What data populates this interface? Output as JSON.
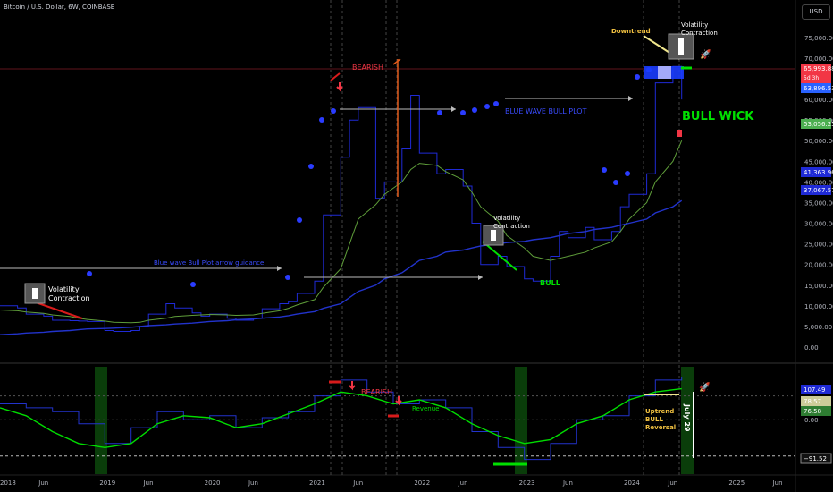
{
  "header": {
    "title": "Bitcoin / U.S. Dollar, 6W, COINBASE",
    "currency": "USD"
  },
  "price_axis": {
    "ticks": [
      "75,000.00",
      "70,000.00",
      "60,000.00",
      "55,000.00",
      "50,000.00",
      "45,000.00",
      "40,000.00",
      "35,000.00",
      "30,000.00",
      "25,000.00",
      "20,000.00",
      "15,000.00",
      "10,000.00",
      "5,000.00",
      "0.00"
    ],
    "badges": [
      {
        "label": "65,993.88",
        "sub": "5d 3h",
        "color": "#f23645"
      },
      {
        "label": "63,896.53",
        "color": "#2962ff"
      },
      {
        "label": "53,056.25",
        "color": "#4caf50"
      },
      {
        "label": "41,363.96",
        "color": "#1f2ad6"
      },
      {
        "label": "37,067.57",
        "color": "#1f2ad6"
      }
    ]
  },
  "osc_axis": {
    "ticks": [
      "0.00"
    ],
    "badges": [
      {
        "label": "107.49",
        "color": "#1f2ad6"
      },
      {
        "label": "78.57",
        "color": "#cccc99"
      },
      {
        "label": "76.58",
        "color": "#2e7d32"
      },
      {
        "label": "−91.52",
        "color": "#111"
      }
    ]
  },
  "time_axis": [
    "2018",
    "Jun",
    "2019",
    "Jun",
    "2020",
    "Jun",
    "2021",
    "Jun",
    "2022",
    "Jun",
    "2023",
    "Jun",
    "2024",
    "Jun",
    "2025",
    "Jun"
  ],
  "annotations": {
    "bearish": "BEARISH",
    "vc_left": "Volatility\nContraction",
    "vc_mid": "Volatility\nContraction",
    "vc_top": "Volatility\nContraction",
    "downtrend": "Downtrend",
    "bull_wick": "BULL WICK",
    "blue_wave": "BLUE WAVE BULL PLOT",
    "blue_wave_guidance": "Blue wave Bull Plot arrow guidance",
    "bull": "BULL",
    "osc_bearish": "BEARISH",
    "revenue": "Revenue",
    "uptrend": "Uptrend\nBULL\nReversal",
    "july": "July 29"
  },
  "chart_data": [
    {
      "type": "line",
      "title": "Bitcoin / U.S. Dollar, 6W, COINBASE",
      "x": [
        "2018-01",
        "2018-03",
        "2018-04",
        "2018-06",
        "2018-07",
        "2018-09",
        "2018-10",
        "2018-11",
        "2019-01",
        "2019-02",
        "2019-04",
        "2019-05",
        "2019-06",
        "2019-08",
        "2019-09",
        "2019-11",
        "2019-12",
        "2020-01",
        "2020-03",
        "2020-04",
        "2020-06",
        "2020-07",
        "2020-09",
        "2020-10",
        "2020-11",
        "2021-01",
        "2021-02",
        "2021-04",
        "2021-05",
        "2021-06",
        "2021-08",
        "2021-09",
        "2021-11",
        "2021-12",
        "2022-01",
        "2022-03",
        "2022-04",
        "2022-06",
        "2022-07",
        "2022-08",
        "2022-10",
        "2022-11",
        "2023-01",
        "2023-02",
        "2023-04",
        "2023-05",
        "2023-06",
        "2023-08",
        "2023-09",
        "2023-11",
        "2023-12",
        "2024-01",
        "2024-03",
        "2024-04",
        "2024-06",
        "2024-07"
      ],
      "series": [
        {
          "values": [
            10000,
            9500,
            8000,
            7500,
            6500,
            6400,
            6300,
            6200,
            4000,
            3800,
            4000,
            5000,
            8000,
            10500,
            9500,
            8300,
            7500,
            8000,
            7000,
            6500,
            7000,
            9300,
            10500,
            11000,
            13000,
            16000,
            32000,
            46000,
            55000,
            58000,
            36000,
            40000,
            48000,
            61000,
            47000,
            42000,
            43000,
            39000,
            30000,
            20000,
            22000,
            19500,
            16500,
            16000,
            22000,
            28000,
            26500,
            29000,
            26000,
            28000,
            34000,
            37000,
            42000,
            64000,
            68000,
            60000
          ]
        },
        {
          "values": [
            9000,
            8800,
            8500,
            8200,
            7800,
            7400,
            7000,
            6700,
            6300,
            6000,
            5900,
            6000,
            6500,
            7000,
            7400,
            7700,
            7800,
            7900,
            7800,
            7700,
            7800,
            8200,
            8800,
            9400,
            10200,
            11500,
            14500,
            19000,
            25000,
            31000,
            34500,
            37000,
            40000,
            43000,
            44500,
            44000,
            42500,
            40500,
            37500,
            34000,
            30500,
            27000,
            24000,
            22000,
            21000,
            21500,
            22000,
            23000,
            24000,
            25500,
            28000,
            31000,
            35000,
            40000,
            45000,
            50000
          ]
        },
        {
          "values": [
            3000,
            3200,
            3400,
            3600,
            3800,
            4000,
            4200,
            4400,
            4500,
            4600,
            4800,
            5000,
            5200,
            5400,
            5600,
            5800,
            6000,
            6200,
            6400,
            6600,
            6800,
            7000,
            7300,
            7600,
            8000,
            8600,
            9400,
            10500,
            12000,
            13500,
            15000,
            16500,
            18000,
            19500,
            21000,
            22000,
            23000,
            23500,
            24000,
            24500,
            25000,
            25300,
            25600,
            26000,
            26500,
            27000,
            27500,
            28000,
            28500,
            29000,
            29500,
            30000,
            31000,
            32500,
            34000,
            35500
          ]
        }
      ],
      "ylim": [
        0,
        78000
      ]
    },
    {
      "type": "line",
      "x": [
        "2018-01",
        "2018-04",
        "2018-07",
        "2018-10",
        "2019-01",
        "2019-04",
        "2019-07",
        "2019-10",
        "2020-01",
        "2020-04",
        "2020-07",
        "2020-10",
        "2021-01",
        "2021-04",
        "2021-07",
        "2021-10",
        "2022-01",
        "2022-04",
        "2022-07",
        "2022-10",
        "2023-01",
        "2023-04",
        "2023-07",
        "2023-10",
        "2024-01",
        "2024-04",
        "2024-07"
      ],
      "series": [
        {
          "values": [
            40,
            30,
            20,
            -10,
            -60,
            -20,
            20,
            0,
            10,
            -20,
            5,
            20,
            60,
            100,
            70,
            40,
            50,
            30,
            -30,
            -70,
            -100,
            -60,
            0,
            10,
            60,
            100,
            107
          ]
        },
        {
          "values": [
            30,
            10,
            -30,
            -60,
            -70,
            -60,
            -10,
            10,
            5,
            -20,
            -10,
            15,
            40,
            70,
            60,
            40,
            50,
            30,
            -10,
            -40,
            -60,
            -50,
            -10,
            10,
            50,
            70,
            78
          ]
        }
      ],
      "ylim": [
        -110,
        120
      ]
    }
  ]
}
